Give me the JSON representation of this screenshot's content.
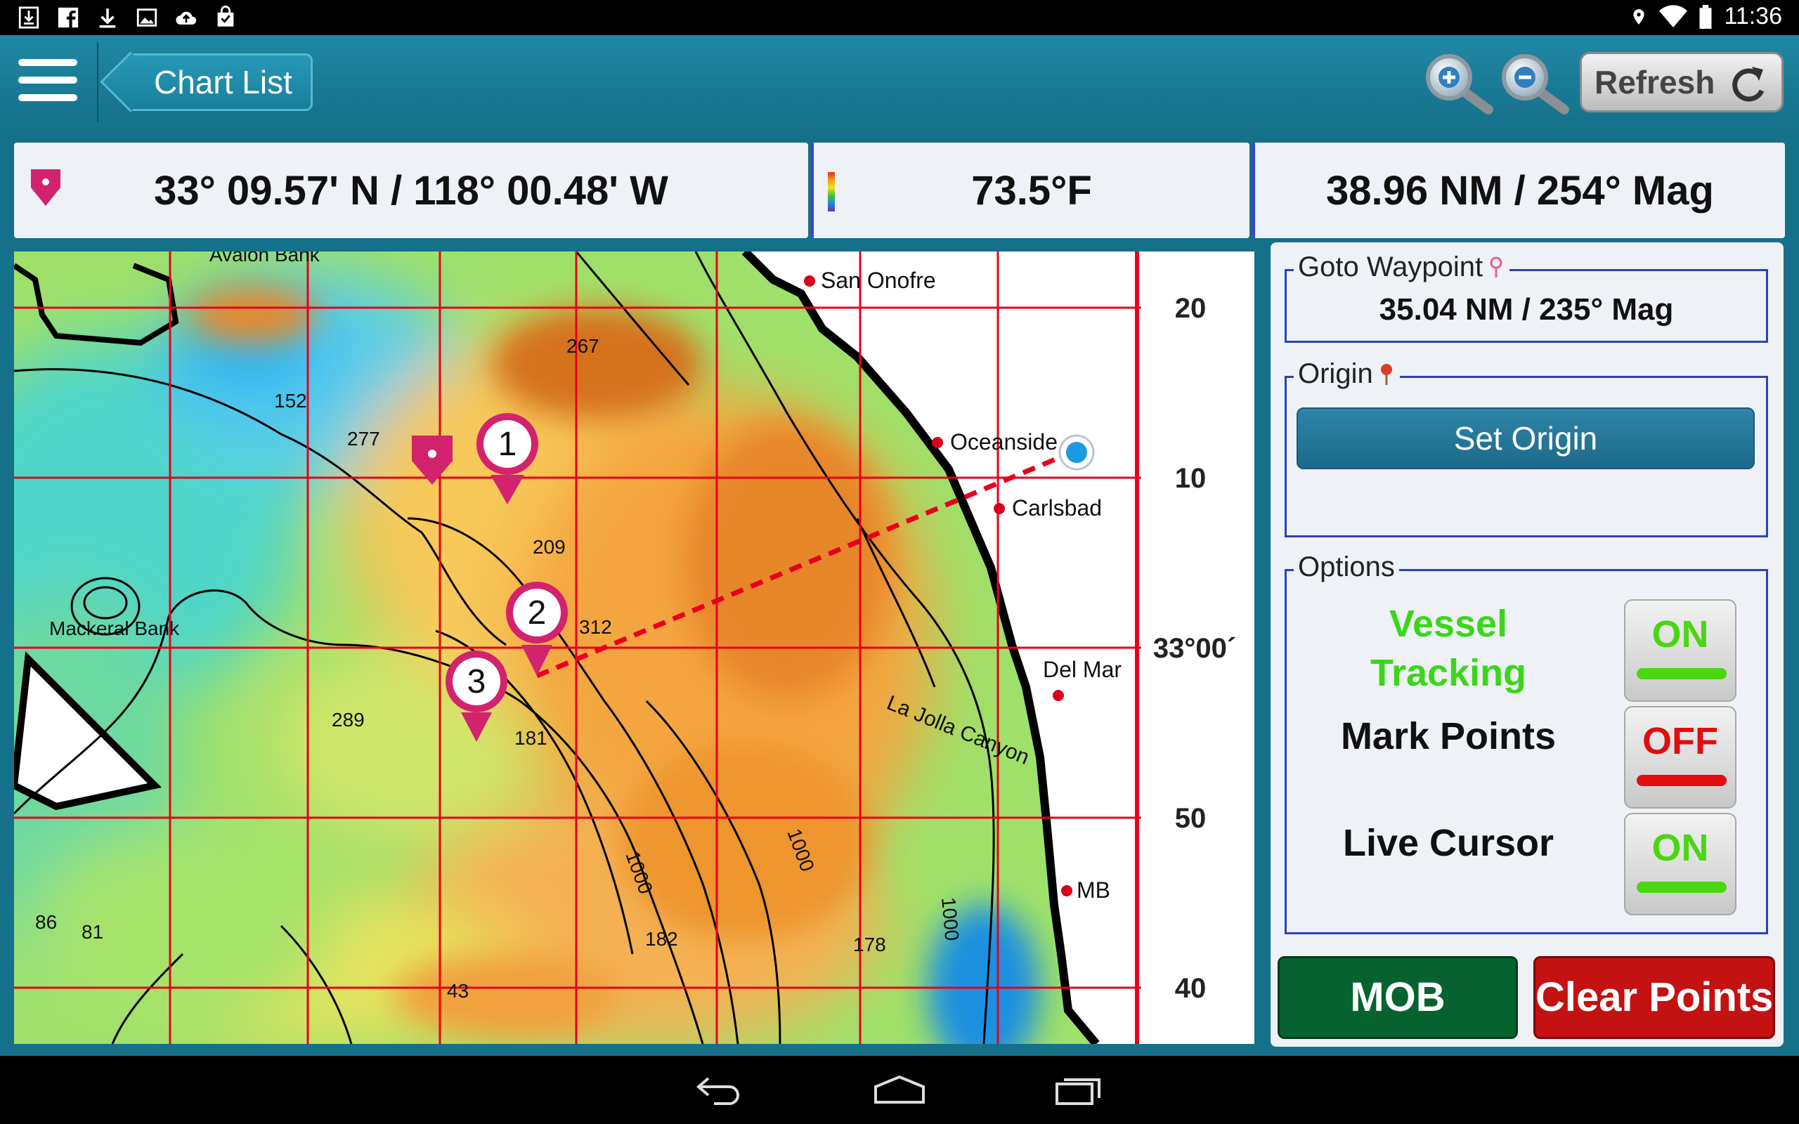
{
  "status_bar": {
    "time": "11:36",
    "left_icons": [
      "download-box-icon",
      "facebook-icon",
      "download-icon",
      "image-icon",
      "cloud-upload-icon",
      "shopping-bag-icon"
    ],
    "right_icons": [
      "location-icon",
      "wifi-icon",
      "battery-icon"
    ]
  },
  "header": {
    "menu_icon": "hamburger-menu-icon",
    "back_button_label": "Chart List",
    "zoom_in_icon": "zoom-in-icon",
    "zoom_out_icon": "zoom-out-icon",
    "refresh_label": "Refresh",
    "refresh_icon": "refresh-icon"
  },
  "info_bar": {
    "position": "33° 09.57' N / 118° 00.48' W",
    "temperature": "73.5°F",
    "range_bearing": "38.96 NM / 254° Mag"
  },
  "map": {
    "place_labels": [
      "San Onofre",
      "Oceanside",
      "Carlsbad",
      "Del Mar",
      "MB",
      "Avalon Bank",
      "Mackeral Bank",
      "La Jolla Canyon"
    ],
    "depth_labels": [
      "267",
      "152",
      "277",
      "209",
      "312",
      "289",
      "181",
      "182",
      "178",
      "43",
      "86",
      "81"
    ],
    "contour_labels": [
      "1000",
      "1000",
      "1000"
    ],
    "lat_labels": [
      "20",
      "10",
      "33°00´",
      "50",
      "40"
    ],
    "waypoint_markers": [
      "1",
      "2",
      "3"
    ],
    "colors": {
      "grid": "#e8001c",
      "route": "#e8001c",
      "marker": "#d3226e",
      "vessel": "#1b9ae4"
    }
  },
  "panel": {
    "goto_waypoint": {
      "legend": "Goto Waypoint",
      "value": "35.04 NM / 235° Mag"
    },
    "origin": {
      "legend": "Origin",
      "button_label": "Set Origin"
    },
    "options": {
      "legend": "Options",
      "items": [
        {
          "label": "Vessel Tracking",
          "label_line1": "Vessel",
          "label_line2": "Tracking",
          "state": "ON",
          "color": "#3bd61a"
        },
        {
          "label": "Mark Points",
          "state": "OFF",
          "color": "#111111"
        },
        {
          "label": "Live Cursor",
          "state": "ON",
          "color": "#111111"
        }
      ]
    },
    "mob_label": "MOB",
    "clear_points_label": "Clear Points"
  },
  "nav_bar": {
    "icons": [
      "back-icon",
      "home-icon",
      "recent-apps-icon"
    ]
  }
}
